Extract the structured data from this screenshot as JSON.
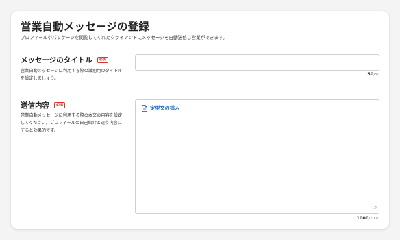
{
  "page": {
    "title": "営業自動メッセージの登録",
    "subtitle": "プロフィールやパッケージを閲覧してくれたクライアントにメッセージを自動送信し営業ができます。"
  },
  "title_section": {
    "label": "メッセージのタイトル",
    "required_badge": "必須",
    "description": "営業自動メッセージに利用する際の識別用のタイトルを設定しましょう。",
    "input_value": "",
    "counter_current": "50",
    "counter_max": "/50"
  },
  "body_section": {
    "label": "送信内容",
    "required_badge": "必須",
    "description": "営業自動メッセージに利用する際の本文の内容を設定してください。プロフィールの自己紹介と違う内容にすると効果的です。",
    "insert_template_label": "定型文の挿入",
    "textarea_value": "",
    "counter_current": "1000",
    "counter_max": "/1000"
  },
  "icons": {
    "insert_template": "document-icon",
    "resize": "resize-grip-icon"
  },
  "colors": {
    "required": "#dd3333",
    "link": "#1565c0"
  }
}
